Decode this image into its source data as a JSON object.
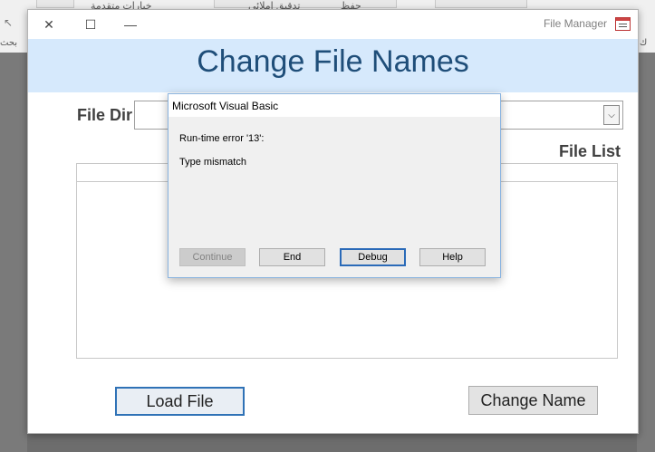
{
  "background": {
    "ribbon_text_1": "خيارات متقدمة",
    "ribbon_text_2": "تدقيق إملائي",
    "ribbon_text_3": "حفظ",
    "left_edge_text": "بحث",
    "right_edge_text": "ك"
  },
  "window": {
    "title": "File Manager",
    "close_glyph": "✕",
    "restore_glyph": "☐",
    "minimize_glyph": "—"
  },
  "form": {
    "heading": "Change File Names",
    "file_dir_label": "File Dir",
    "file_dir_value": "",
    "file_list_label": "File List",
    "load_button": "Load File",
    "change_button": "Change Name",
    "dropdown_glyph": "⌵"
  },
  "dialog": {
    "title": "Microsoft Visual Basic",
    "error_line": "Run-time error '13':",
    "error_message": "Type mismatch",
    "buttons": {
      "continue": "Continue",
      "end": "End",
      "debug": "Debug",
      "help": "Help"
    }
  },
  "colors": {
    "banner": "#d6e9fc",
    "heading": "#1f4e79",
    "accent_border": "#2f72b6"
  }
}
